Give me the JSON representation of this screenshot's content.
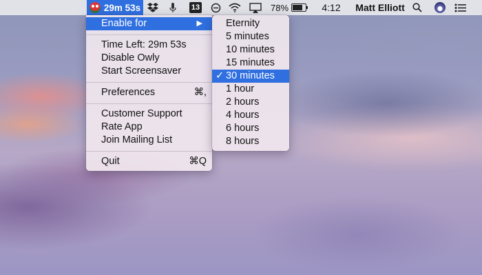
{
  "menubar": {
    "owly_timer": "29m 53s",
    "badge_count": "13",
    "battery_percent": "78%",
    "clock": "4:12",
    "user_name": "Matt Elliott"
  },
  "main_menu": {
    "enable_for": "Enable for",
    "time_left": "Time Left: 29m 53s",
    "disable": "Disable Owly",
    "screensaver": "Start Screensaver",
    "preferences": "Preferences",
    "preferences_shortcut": "⌘,",
    "support": "Customer Support",
    "rate": "Rate App",
    "mailing": "Join Mailing List",
    "quit": "Quit",
    "quit_shortcut": "⌘Q"
  },
  "submenu": {
    "items": [
      "Eternity",
      "5 minutes",
      "10 minutes",
      "15 minutes",
      "30 minutes",
      "1 hour",
      "2 hours",
      "4 hours",
      "6 hours",
      "8 hours"
    ],
    "selected": "30 minutes",
    "check_glyph": "✓"
  },
  "colors": {
    "accent": "#2f6fe0"
  }
}
